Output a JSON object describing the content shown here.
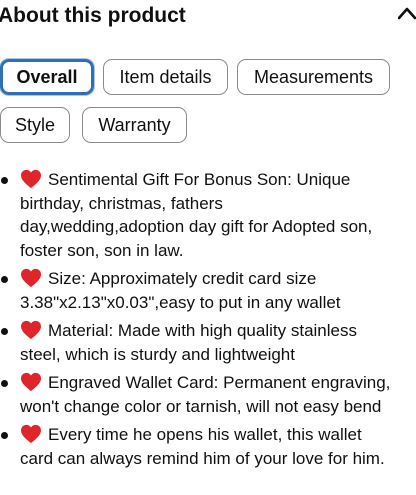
{
  "section": {
    "title": "About this product",
    "collapse_icon": "chevron-up-icon"
  },
  "tabs": [
    {
      "label": "Overall",
      "selected": true
    },
    {
      "label": "Item details",
      "selected": false
    },
    {
      "label": "Measurements",
      "selected": false
    },
    {
      "label": "Style",
      "selected": false
    },
    {
      "label": "Warranty",
      "selected": false
    }
  ],
  "bullets": [
    {
      "icon": "red-heart-icon",
      "lines": [
        "Sentimental Gift For Bonus Son: Unique",
        "birthday, christmas, fathers",
        "day,wedding,adoption day gift for Adopted son,",
        "foster son, son in law."
      ]
    },
    {
      "icon": "red-heart-icon",
      "lines": [
        "Size: Approximately credit card size",
        "3.38\"x2.13\"x0.03\",easy to put in any wallet"
      ]
    },
    {
      "icon": "red-heart-icon",
      "lines": [
        "Material: Made with high quality stainless",
        "steel, which is sturdy and lightweight"
      ]
    },
    {
      "icon": "red-heart-icon",
      "lines": [
        "Engraved Wallet Card: Permanent engraving,",
        "won't change color or tarnish, will not easy bend"
      ]
    },
    {
      "icon": "red-heart-icon",
      "lines": [
        "Every time he opens his wallet, this wallet",
        "card can always remind him of your love for him."
      ]
    }
  ],
  "colors": {
    "text": "#0f1111",
    "chip_border": "#888c8c",
    "selected_border": "#2f6fb2",
    "heart": "#e0242c"
  }
}
